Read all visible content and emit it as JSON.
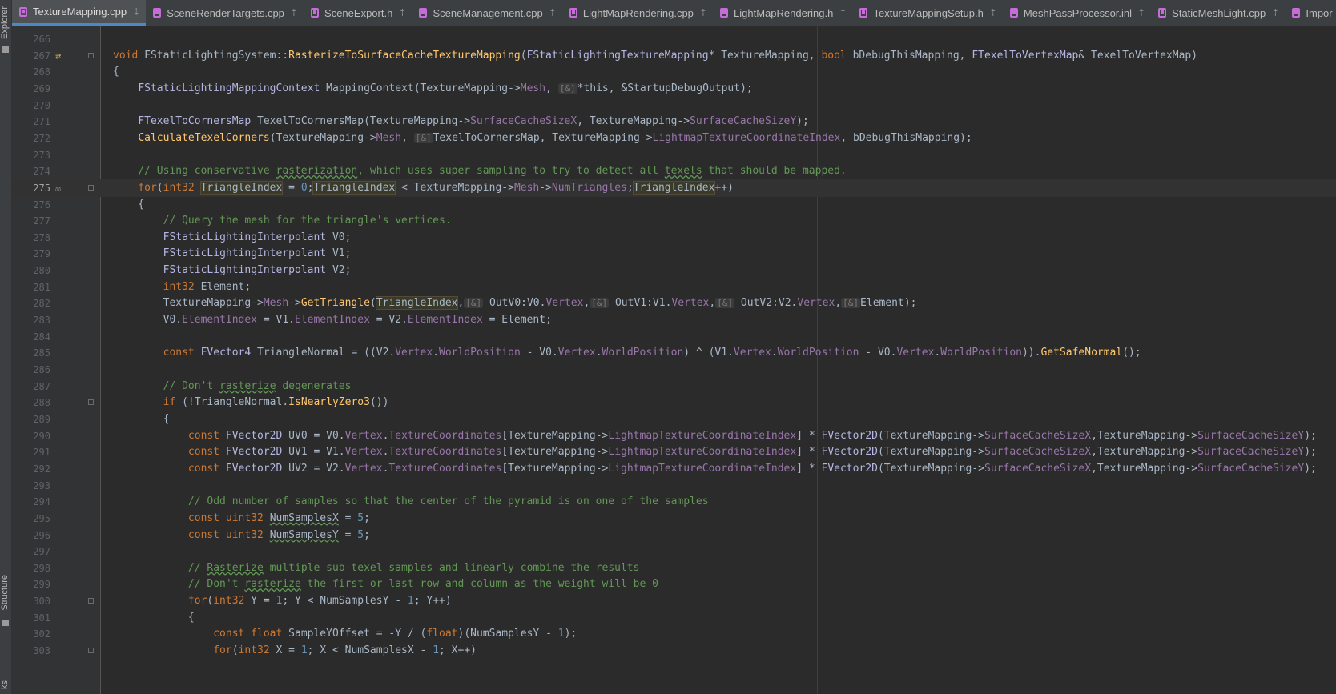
{
  "sidebar": {
    "explorer_label": "Explorer",
    "structure_label": "Structure",
    "bookmarks_label": "ks"
  },
  "tabs": [
    {
      "label": "TextureMapping.cpp",
      "active": true
    },
    {
      "label": "SceneRenderTargets.cpp"
    },
    {
      "label": "SceneExport.h"
    },
    {
      "label": "SceneManagement.cpp"
    },
    {
      "label": "LightMapRendering.cpp"
    },
    {
      "label": "LightMapRendering.h"
    },
    {
      "label": "TextureMappingSetup.h"
    },
    {
      "label": "MeshPassProcessor.inl"
    },
    {
      "label": "StaticMeshLight.cpp"
    },
    {
      "label": "Impor"
    }
  ],
  "current_line": 275,
  "lines": [
    {
      "n": "266",
      "t": ""
    },
    {
      "n": "267",
      "t": "void FStaticLightingSystem::RasterizeToSurfaceCacheTextureMapping(FStaticLightingTextureMapping* TextureMapping, bool bDebugThisMapping, FTexelToVertexMap& TexelToVertexMap)"
    },
    {
      "n": "268",
      "t": "{"
    },
    {
      "n": "269",
      "t": "    FStaticLightingMappingContext MappingContext(TextureMapping->Mesh, [&]*this, &StartupDebugOutput);"
    },
    {
      "n": "270",
      "t": ""
    },
    {
      "n": "271",
      "t": "    FTexelToCornersMap TexelToCornersMap(TextureMapping->SurfaceCacheSizeX, TextureMapping->SurfaceCacheSizeY);"
    },
    {
      "n": "272",
      "t": "    CalculateTexelCorners(TextureMapping->Mesh, [&]TexelToCornersMap, TextureMapping->LightmapTextureCoordinateIndex, bDebugThisMapping);"
    },
    {
      "n": "273",
      "t": ""
    },
    {
      "n": "274",
      "t": "    // Using conservative rasterization, which uses super sampling to try to detect all texels that should be mapped."
    },
    {
      "n": "275",
      "t": "    for(int32 TriangleIndex = 0;TriangleIndex < TextureMapping->Mesh->NumTriangles;TriangleIndex++)"
    },
    {
      "n": "276",
      "t": "    {"
    },
    {
      "n": "277",
      "t": "        // Query the mesh for the triangle's vertices."
    },
    {
      "n": "278",
      "t": "        FStaticLightingInterpolant V0;"
    },
    {
      "n": "279",
      "t": "        FStaticLightingInterpolant V1;"
    },
    {
      "n": "280",
      "t": "        FStaticLightingInterpolant V2;"
    },
    {
      "n": "281",
      "t": "        int32 Element;"
    },
    {
      "n": "282",
      "t": "        TextureMapping->Mesh->GetTriangle(TriangleIndex,[&] OutV0:V0.Vertex,[&] OutV1:V1.Vertex,[&] OutV2:V2.Vertex,[&]Element);"
    },
    {
      "n": "283",
      "t": "        V0.ElementIndex = V1.ElementIndex = V2.ElementIndex = Element;"
    },
    {
      "n": "284",
      "t": ""
    },
    {
      "n": "285",
      "t": "        const FVector4 TriangleNormal = ((V2.Vertex.WorldPosition - V0.Vertex.WorldPosition) ^ (V1.Vertex.WorldPosition - V0.Vertex.WorldPosition)).GetSafeNormal();"
    },
    {
      "n": "286",
      "t": ""
    },
    {
      "n": "287",
      "t": "        // Don't rasterize degenerates"
    },
    {
      "n": "288",
      "t": "        if (!TriangleNormal.IsNearlyZero3())"
    },
    {
      "n": "289",
      "t": "        {"
    },
    {
      "n": "290",
      "t": "            const FVector2D UV0 = V0.Vertex.TextureCoordinates[TextureMapping->LightmapTextureCoordinateIndex] * FVector2D(TextureMapping->SurfaceCacheSizeX,TextureMapping->SurfaceCacheSizeY);"
    },
    {
      "n": "291",
      "t": "            const FVector2D UV1 = V1.Vertex.TextureCoordinates[TextureMapping->LightmapTextureCoordinateIndex] * FVector2D(TextureMapping->SurfaceCacheSizeX,TextureMapping->SurfaceCacheSizeY);"
    },
    {
      "n": "292",
      "t": "            const FVector2D UV2 = V2.Vertex.TextureCoordinates[TextureMapping->LightmapTextureCoordinateIndex] * FVector2D(TextureMapping->SurfaceCacheSizeX,TextureMapping->SurfaceCacheSizeY);"
    },
    {
      "n": "293",
      "t": ""
    },
    {
      "n": "294",
      "t": "            // Odd number of samples so that the center of the pyramid is on one of the samples"
    },
    {
      "n": "295",
      "t": "            const uint32 NumSamplesX = 5;"
    },
    {
      "n": "296",
      "t": "            const uint32 NumSamplesY = 5;"
    },
    {
      "n": "297",
      "t": ""
    },
    {
      "n": "298",
      "t": "            // Rasterize multiple sub-texel samples and linearly combine the results"
    },
    {
      "n": "299",
      "t": "            // Don't rasterize the first or last row and column as the weight will be 0"
    },
    {
      "n": "300",
      "t": "            for(int32 Y = 1; Y < NumSamplesY - 1; Y++)"
    },
    {
      "n": "301",
      "t": "            {"
    },
    {
      "n": "302",
      "t": "                const float SampleYOffset = -Y / (float)(NumSamplesY - 1);"
    },
    {
      "n": "303",
      "t": "                for(int32 X = 1; X < NumSamplesX - 1; X++)"
    }
  ]
}
